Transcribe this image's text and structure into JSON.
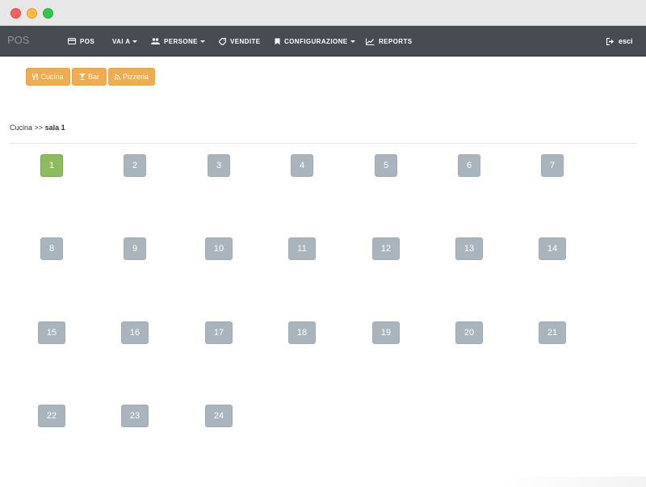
{
  "navbar": {
    "brand": "POS",
    "items": [
      {
        "label": "POS",
        "icon": "credit-card-icon"
      },
      {
        "label": "VAI A",
        "icon": "",
        "dropdown": true
      },
      {
        "label": "PERSONE",
        "icon": "users-icon",
        "dropdown": true
      },
      {
        "label": "VENDITE",
        "icon": "tag-icon"
      },
      {
        "label": "CONFIGURAZIONE",
        "icon": "bookmark-icon",
        "dropdown": true
      },
      {
        "label": "REPORTS",
        "icon": "line-chart-icon"
      }
    ],
    "logout_label": "esci"
  },
  "categories": [
    {
      "label": "Cucina",
      "icon": "cutlery-icon"
    },
    {
      "label": "Bar",
      "icon": "glass-icon"
    },
    {
      "label": "Pizzeria",
      "icon": "rss-icon"
    }
  ],
  "breadcrumb": {
    "parent": "Cucina",
    "separator": ">>",
    "current": "sala 1"
  },
  "tables": [
    "1",
    "2",
    "3",
    "4",
    "5",
    "6",
    "7",
    "8",
    "9",
    "10",
    "11",
    "12",
    "13",
    "14",
    "15",
    "16",
    "17",
    "18",
    "19",
    "20",
    "21",
    "22",
    "23",
    "24"
  ],
  "active_table": "1",
  "colors": {
    "navbar": "#474b52",
    "warning_button": "#f0ad4e",
    "table_default": "#aab4bd",
    "table_active": "#8cbc5c"
  }
}
